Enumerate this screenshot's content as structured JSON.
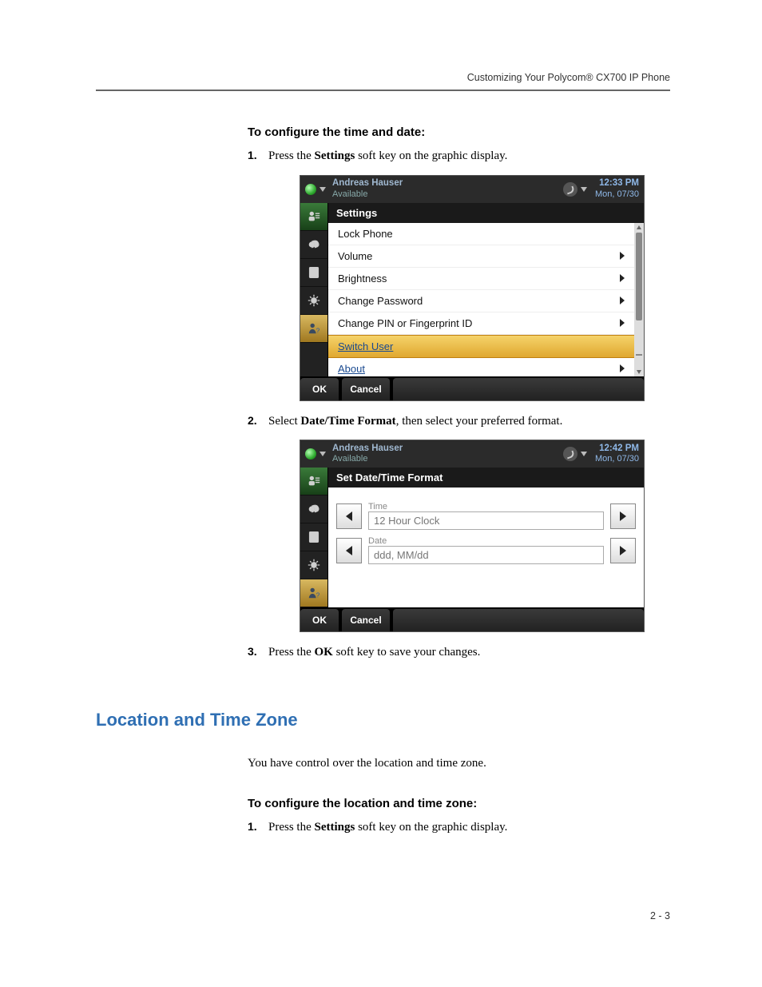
{
  "runningHeader": "Customizing Your Polycom® CX700 IP Phone",
  "pageNumber": "2 - 3",
  "heading1": "To configure the time and date:",
  "steps1": [
    {
      "num": "1.",
      "pre": "Press the ",
      "bold": "Settings",
      "post": " soft key on the graphic display."
    },
    {
      "num": "2.",
      "pre": "Select ",
      "bold": "Date/Time Format",
      "post": ", then select your preferred format."
    },
    {
      "num": "3.",
      "pre": "Press the ",
      "bold": "OK",
      "post": " soft key to save your changes."
    }
  ],
  "sectionHeading": "Location and Time Zone",
  "sectionIntro": "You have control over the location and time zone.",
  "heading2": "To configure the location and time zone:",
  "steps2": [
    {
      "num": "1.",
      "pre": "Press the ",
      "bold": "Settings",
      "post": " soft key on the graphic display."
    }
  ],
  "phone1": {
    "userName": "Andreas Hauser",
    "presence": "Available",
    "time": "12:33 PM",
    "date": "Mon, 07/30",
    "panelTitle": "Settings",
    "items": [
      {
        "label": "Lock Phone",
        "arrow": false
      },
      {
        "label": "Volume",
        "arrow": true
      },
      {
        "label": "Brightness",
        "arrow": true
      },
      {
        "label": "Change Password",
        "arrow": true
      },
      {
        "label": "Change PIN or Fingerprint ID",
        "arrow": true
      },
      {
        "label": "Switch User",
        "arrow": false,
        "selected": true
      },
      {
        "label": "About",
        "arrow": true,
        "link": true
      }
    ],
    "softkeys": {
      "ok": "OK",
      "cancel": "Cancel"
    }
  },
  "phone2": {
    "userName": "Andreas Hauser",
    "presence": "Available",
    "time": "12:42 PM",
    "date": "Mon, 07/30",
    "panelTitle": "Set Date/Time Format",
    "timeLabel": "Time",
    "timeValue": "12 Hour Clock",
    "dateLabel": "Date",
    "dateValue": "ddd, MM/dd",
    "softkeys": {
      "ok": "OK",
      "cancel": "Cancel"
    }
  }
}
